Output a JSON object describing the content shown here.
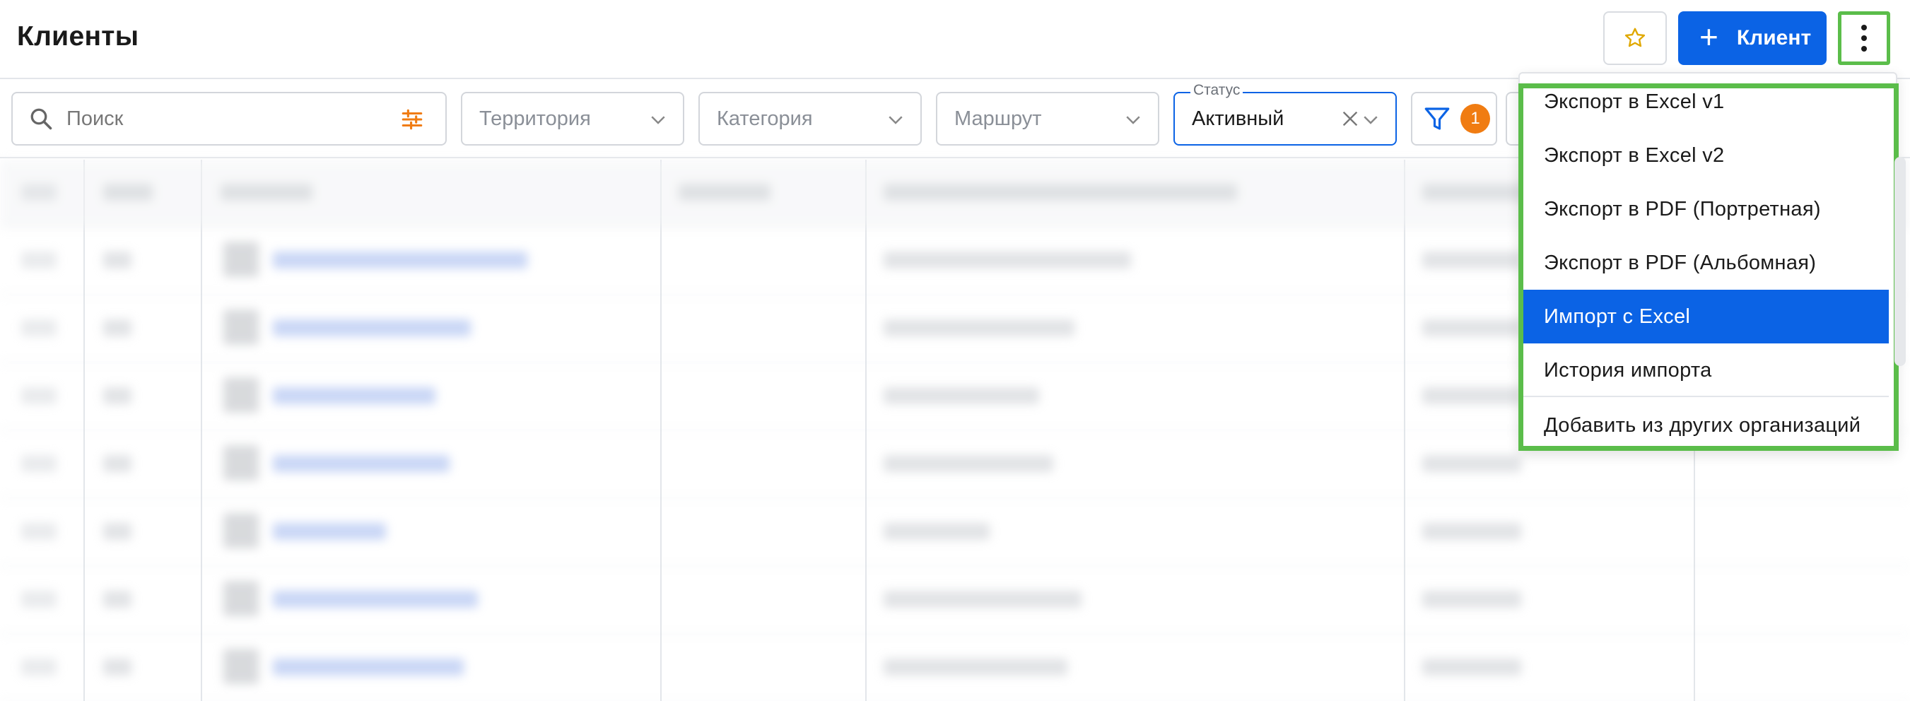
{
  "header": {
    "title": "Клиенты",
    "add_button_label": "Клиент"
  },
  "filters": {
    "search_placeholder": "Поиск",
    "territory": "Территория",
    "category": "Категория",
    "route": "Маршрут",
    "status_label": "Статус",
    "status_value": "Активный",
    "active_filters_count": "1"
  },
  "menu": {
    "items": [
      "Экспорт в Excel v1",
      "Экспорт в Excel v2",
      "Экспорт в PDF (Портретная)",
      "Экспорт в PDF (Альбомная)",
      "Импорт с Excel",
      "История импорта",
      "Добавить из других организаций"
    ],
    "active_index": 4
  },
  "colors": {
    "primary": "#0b63e5",
    "badge": "#f07c12",
    "highlight": "#5bbd4a",
    "star": "#e0a800"
  },
  "icons": [
    "star-icon",
    "plus-icon",
    "more-vertical-icon",
    "search-icon",
    "tune-icon",
    "chevron-down-icon",
    "clear-icon",
    "filter-icon"
  ]
}
